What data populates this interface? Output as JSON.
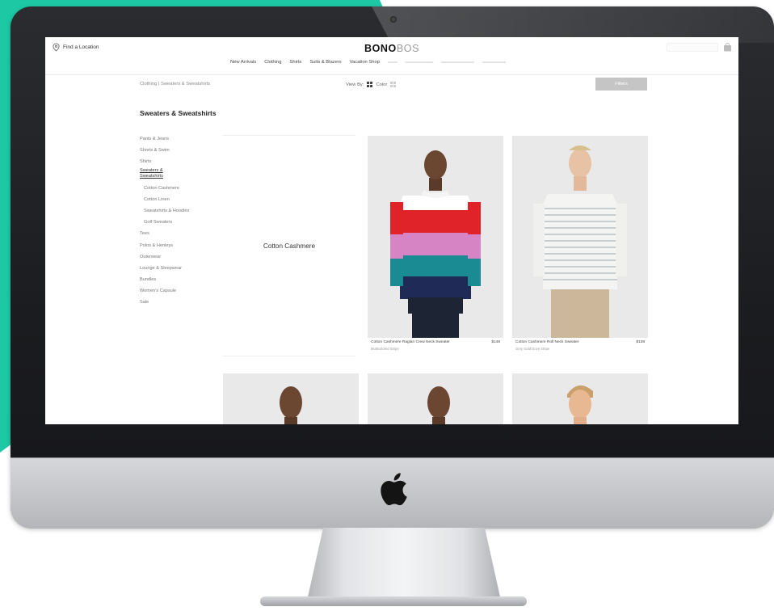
{
  "header": {
    "find_location": "Find a Location",
    "logo_bold": "BONO",
    "logo_light": "BOS"
  },
  "nav": {
    "items": [
      "New Arrivals",
      "Clothing",
      "Shirts",
      "Suits & Blazers",
      "Vacation Shop"
    ]
  },
  "toolbar": {
    "breadcrumb": "Clothing  |  Sweaters & Sweatshirts",
    "view_by_label": "View By:",
    "grid_label": "Color",
    "filters_label": "Filters"
  },
  "page": {
    "title": "Sweaters & Sweatshirts"
  },
  "sidebar": {
    "items": [
      {
        "label": "Pants & Jeans",
        "type": "top"
      },
      {
        "label": "Shorts & Swim",
        "type": "top"
      },
      {
        "label": "Shirts",
        "type": "top"
      },
      {
        "label": "Sweaters & Sweatshirts",
        "type": "active"
      },
      {
        "label": "Cotton Cashmere",
        "type": "sub"
      },
      {
        "label": "Cotton Linen",
        "type": "sub"
      },
      {
        "label": "Sweatshirts & Hoodies",
        "type": "sub"
      },
      {
        "label": "Golf Sweaters",
        "type": "sub"
      },
      {
        "label": "Tees",
        "type": "top"
      },
      {
        "label": "Polos & Henleys",
        "type": "top"
      },
      {
        "label": "Outerwear",
        "type": "top"
      },
      {
        "label": "Lounge & Sleepwear",
        "type": "top"
      },
      {
        "label": "Bundles",
        "type": "top"
      },
      {
        "label": "Women's Capsule",
        "type": "top"
      },
      {
        "label": "Sale",
        "type": "top"
      }
    ]
  },
  "feature": {
    "label": "Cotton Cashmere"
  },
  "products": [
    {
      "name": "Cotton Cashmere Raglan Crew Neck Sweater",
      "color": "Multicolored Stripe",
      "price": "$148"
    },
    {
      "name": "Cotton Cashmere Roll Neck Sweater",
      "color": "Grey Gold Dove Stripe",
      "price": "$138"
    }
  ],
  "colors": {
    "accent": "#1dc9a4",
    "filters_bg": "#c5c5c5"
  }
}
